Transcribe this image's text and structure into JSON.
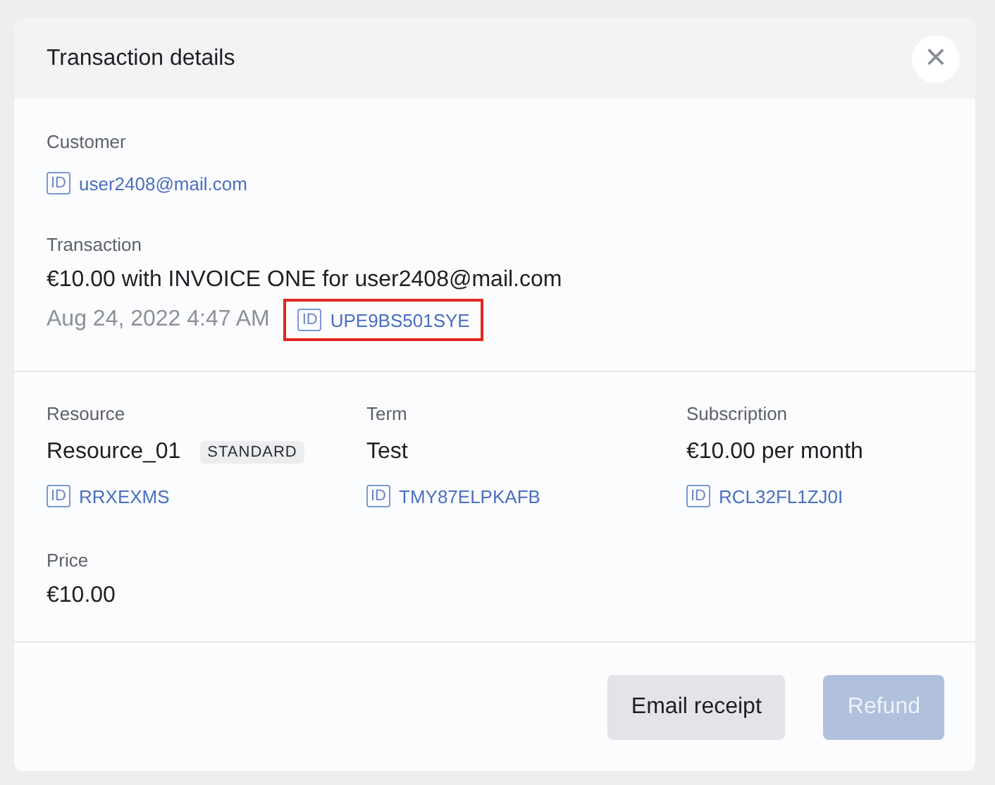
{
  "dialog": {
    "title": "Transaction details",
    "close_icon": "×"
  },
  "customer": {
    "label": "Customer",
    "id": {
      "tag": "ID",
      "value": "user2408@mail.com",
      "highlighted": false
    }
  },
  "transaction": {
    "label": "Transaction",
    "summary": "€10.00 with INVOICE ONE for user2408@mail.com",
    "date": "Aug 24, 2022 4:47 AM",
    "id": {
      "tag": "ID",
      "value": "UPE9BS501SYE",
      "highlighted": true
    }
  },
  "details": [
    {
      "label": "Resource",
      "value": "Resource_01",
      "badge": "STANDARD",
      "id": {
        "tag": "ID",
        "value": "RRXEXMS",
        "highlighted": false
      }
    },
    {
      "label": "Term",
      "value": "Test",
      "id": {
        "tag": "ID",
        "value": "TMY87ELPKAFB",
        "highlighted": false
      }
    },
    {
      "label": "Subscription",
      "value": "€10.00 per month",
      "id": {
        "tag": "ID",
        "value": "RCL32FL1ZJ0I",
        "highlighted": false
      }
    }
  ],
  "price": {
    "label": "Price",
    "value": "€10.00"
  },
  "buttons": [
    {
      "label": "Email receipt",
      "kind": "secondary",
      "disabled": false
    },
    {
      "label": "Refund",
      "kind": "primary",
      "disabled": true
    }
  ]
}
